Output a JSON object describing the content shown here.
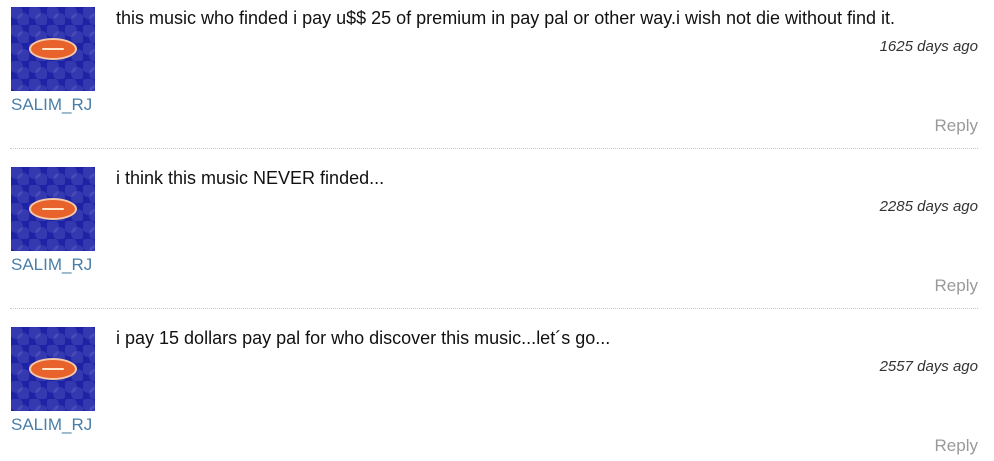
{
  "comments": [
    {
      "author": "SALIM_RJ",
      "avatar_icon": "orange-oval-logo-icon",
      "text": "this music who finded i pay u$$ 25 of premium in pay pal or other way.i wish not die without find it.",
      "time": "1625 days ago",
      "reply_label": "Reply"
    },
    {
      "author": "SALIM_RJ",
      "avatar_icon": "orange-oval-logo-icon",
      "text": "i think this music NEVER finded...",
      "time": "2285 days ago",
      "reply_label": "Reply"
    },
    {
      "author": "SALIM_RJ",
      "avatar_icon": "orange-oval-logo-icon",
      "text": "i pay 15 dollars pay pal for who discover this music...let´s go...",
      "time": "2557 days ago",
      "reply_label": "Reply"
    }
  ],
  "colors": {
    "avatar_bg": "#1e23a6",
    "badge": "#e8622b",
    "author_link": "#4a7fa8",
    "reply_link": "#9a9a9a"
  }
}
